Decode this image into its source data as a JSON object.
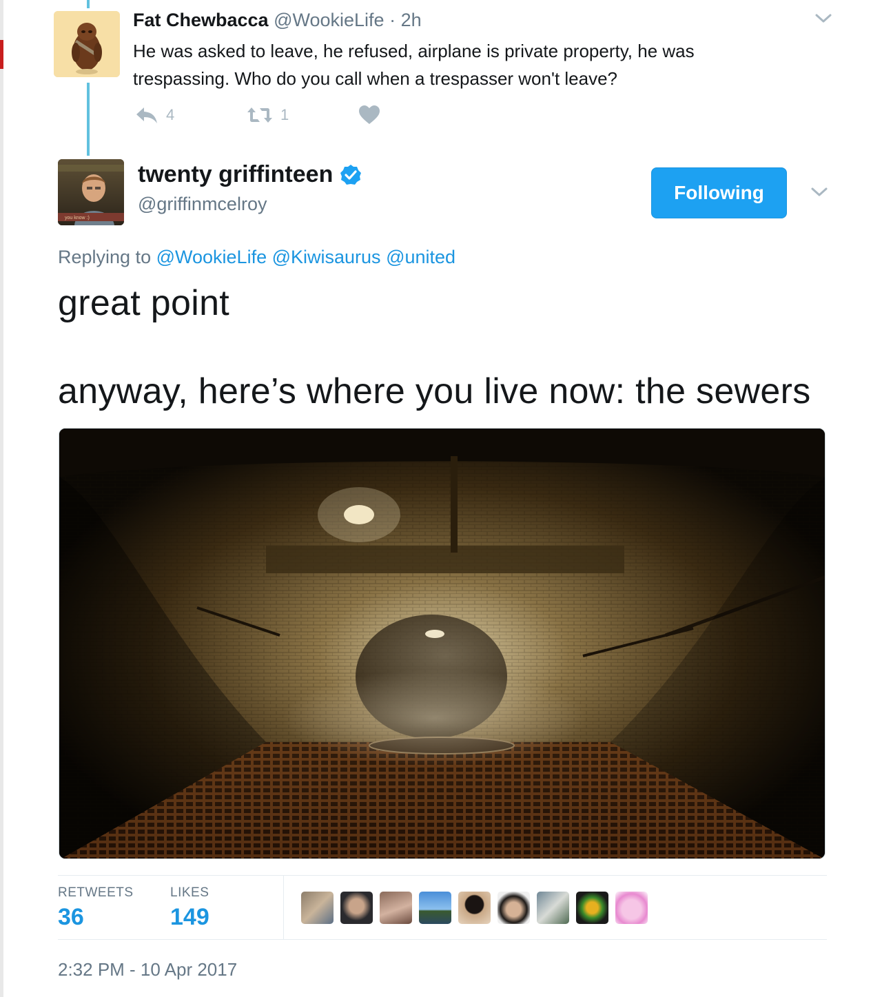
{
  "reply": {
    "name": "Fat Chewbacca",
    "handle": "@WookieLife",
    "separator": "·",
    "time": "2h",
    "text_line1": "He was asked to leave, he refused, airplane is private property, he was",
    "text_line2": "trespassing.  Who do you call when a trespasser won't leave?",
    "reply_count": "4",
    "retweet_count": "1"
  },
  "tweet": {
    "name": "twenty griffinteen",
    "handle": "@griffinmcelroy",
    "follow_label": "Following",
    "replying_prefix": "Replying to",
    "mentions": [
      "@WookieLife",
      "@Kiwisaurus",
      "@united"
    ],
    "line1": "great point",
    "line2": "anyway, here’s where you live now: the sewers",
    "retweets_label": "RETWEETS",
    "retweets": "36",
    "likes_label": "LIKES",
    "likes": "149",
    "timestamp": "2:32 PM - 10 Apr 2017"
  },
  "colors": {
    "link": "#1b95e0",
    "follow_bg": "#1da1f2",
    "muted": "#657786",
    "thread_line": "#61c1df",
    "action_icon": "#aab8c2"
  },
  "icons": [
    "chevron-down-icon",
    "reply-icon",
    "retweet-icon",
    "heart-icon",
    "verified-badge-icon"
  ]
}
